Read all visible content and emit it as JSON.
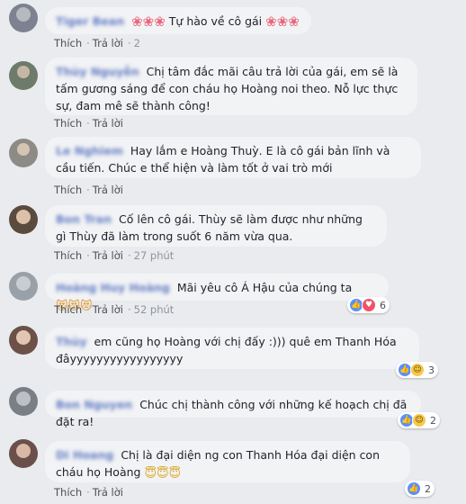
{
  "ui": {
    "like_label": "Thích",
    "reply_label": "Trả lời",
    "separator": "·"
  },
  "comments": [
    {
      "name": "Tiger Bean",
      "text": "Tự hào về cô gái",
      "time": "2",
      "reactions": null
    },
    {
      "name": "Thùy Nguyễn",
      "text": "Chị tâm đắc mãi câu trả lời của gái, em sẽ là tấm gương sáng để con cháu họ Hoàng noi theo. Nỗ lực thực sự, đam mê sẽ thành công!",
      "time": "",
      "reactions": null
    },
    {
      "name": "Le Nghiem",
      "text": "Hay lắm e Hoàng Thuỳ. E là cô gái bản lĩnh và cầu tiến. Chúc e thể hiện và làm tốt ở vai trò mới",
      "time": "",
      "reactions": null
    },
    {
      "name": "Bon Tran",
      "text": "Cố lên cô gái. Thùy sẽ làm được như những gì Thùy đã làm trong suốt 6 năm vừa qua.",
      "time": "27 phút",
      "reactions": null
    },
    {
      "name": "Hoàng Huy Hoàng",
      "text": "Mãi yêu cô Á Hậu của chúng ta",
      "time": "52 phút",
      "reactions": {
        "count": "6"
      }
    },
    {
      "name": "Thùy",
      "text": "em cũng họ Hoàng với chị đấy :))) quê em Thanh Hóa đâyyyyyyyyyyyyyyyyy",
      "time": "",
      "reactions": {
        "count": "3"
      }
    },
    {
      "name": "Bon Nguyen",
      "text": "Chúc chị thành công với những kế hoạch chị đã đặt ra!",
      "time": "",
      "reactions": {
        "count": "2"
      }
    },
    {
      "name": "Di Hoang",
      "text": "Chị là đại diện ng con Thanh Hóa đại diện con cháu họ Hoàng",
      "time": "",
      "reactions": {
        "count": "2"
      }
    }
  ]
}
